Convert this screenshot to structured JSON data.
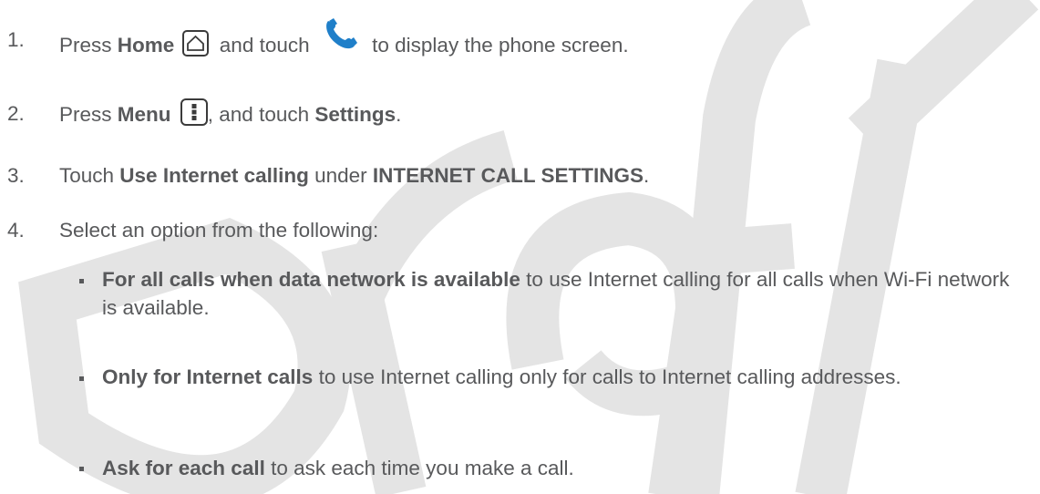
{
  "watermark": {
    "text": "Draft",
    "color": "#e4e4e4"
  },
  "steps": [
    {
      "number": "1.",
      "pre": "Press ",
      "bold1": "Home",
      "mid": " and touch ",
      "post": " to display the phone screen.",
      "icons": [
        "home-icon",
        "phone-icon"
      ]
    },
    {
      "number": "2.",
      "pre": "Press ",
      "bold1": "Menu",
      "mid": ", and touch ",
      "bold2": "Settings",
      "post": ".",
      "icons": [
        "menu-icon"
      ]
    },
    {
      "number": "3.",
      "pre": "Touch ",
      "bold1": "Use Internet calling",
      "mid": " under ",
      "bold2": "INTERNET CALL SETTINGS",
      "post": "."
    },
    {
      "number": "4.",
      "text": "Select an option from the following:"
    }
  ],
  "options": [
    {
      "bold": "For all calls when data network is available",
      "text": " to use Internet calling for all calls when Wi-Fi network is available."
    },
    {
      "bold": "Only for Internet calls",
      "text": " to use Internet calling only for calls to Internet calling addresses."
    },
    {
      "bold": "Ask for each call",
      "text": " to ask each time you make a call."
    }
  ],
  "colors": {
    "text": "#58595b",
    "phone_icon": "#1f7fc9"
  }
}
